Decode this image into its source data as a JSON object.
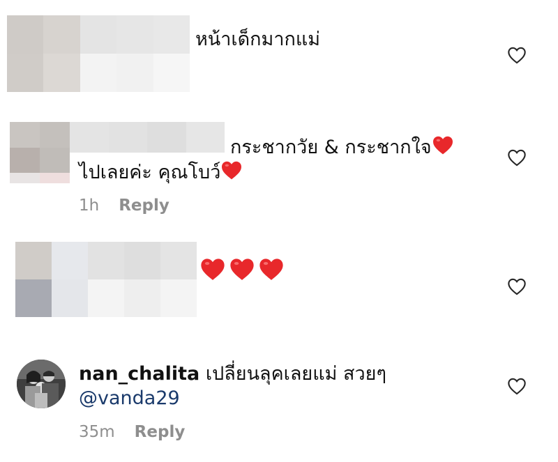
{
  "comments": [
    {
      "text": "หน้าเด็กมากแม่"
    },
    {
      "text_line1": "กระชากวัย & กระชากใจ",
      "text_line2": "ไปเลยค่ะ คุณโบว์",
      "time": "1h",
      "reply": "Reply"
    },
    {
      "text": ""
    },
    {
      "username": "nan_chalita",
      "text": "เปลี่ยนลุคเลยแม่ สวยๆ",
      "mention": "@vanda29",
      "time": "35m",
      "reply": "Reply"
    }
  ],
  "icons": {
    "like": "heart-outline-icon",
    "emoji": "red-heart-emoji"
  },
  "colors": {
    "meta": "#8e8e8e",
    "heart": "#e8282b",
    "mention": "#1a3a6b"
  }
}
